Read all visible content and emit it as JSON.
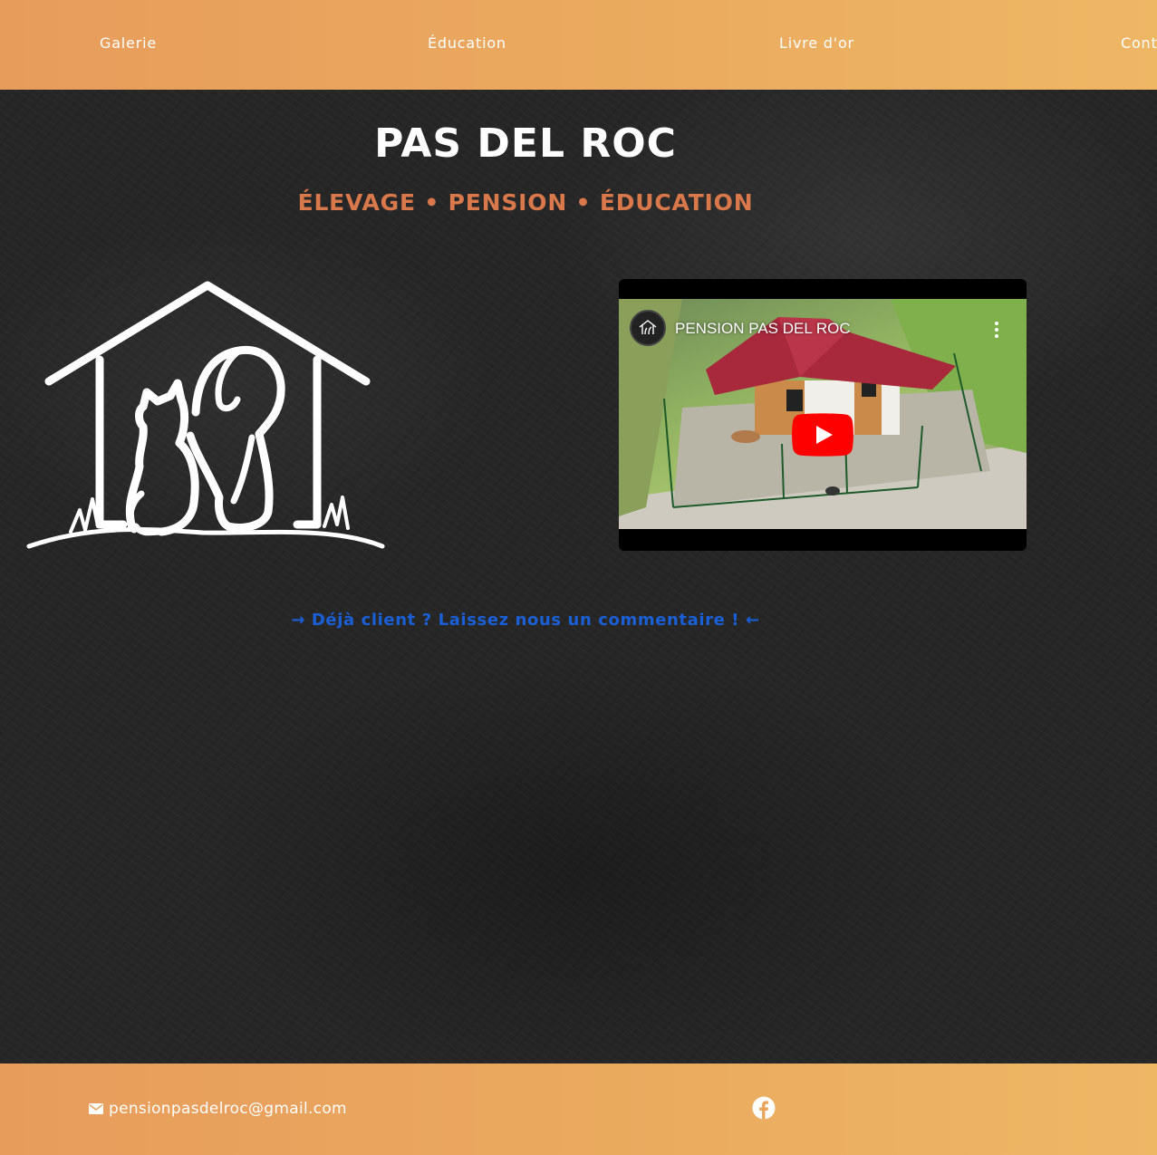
{
  "nav": {
    "items": [
      {
        "label": "Galerie"
      },
      {
        "label": "Éducation"
      },
      {
        "label": "Livre d'or"
      },
      {
        "label": "Cont"
      }
    ]
  },
  "hero": {
    "title": "PAS DEL ROC",
    "tagline": "ÉLEVAGE • PENSION • ÉDUCATION",
    "logo_icon": "house-cat-dog-logo-icon"
  },
  "video": {
    "title": "PENSION PAS DEL ROC",
    "avatar_text": "PAS DEL ROC",
    "play_icon": "youtube-play-icon"
  },
  "review_link": {
    "label": "→ Déjà client ? Laissez nous un commentaire ! ←"
  },
  "footer": {
    "email": "pensionpasdelroc@gmail.com",
    "email_icon": "envelope-icon",
    "social_icon": "facebook-icon"
  },
  "colors": {
    "nav_bg_start": "#e79c5c",
    "nav_bg_end": "#eeb764",
    "tagline": "#d9784a",
    "link": "#1a5fd6",
    "youtube_red": "#ff0000"
  }
}
